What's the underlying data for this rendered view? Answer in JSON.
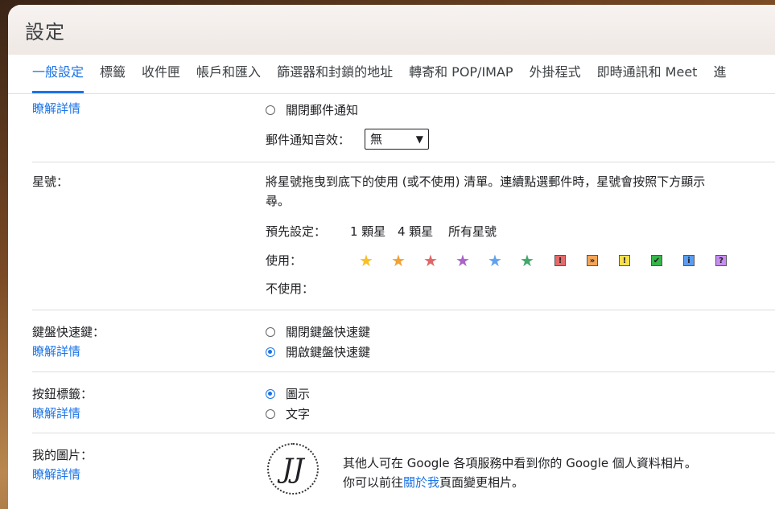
{
  "header": {
    "title": "設定"
  },
  "tabs": [
    {
      "label": "一般設定"
    },
    {
      "label": "標籤"
    },
    {
      "label": "收件匣"
    },
    {
      "label": "帳戶和匯入"
    },
    {
      "label": "篩選器和封鎖的地址"
    },
    {
      "label": "轉寄和 POP/IMAP"
    },
    {
      "label": "外掛程式"
    },
    {
      "label": "即時通訊和 Meet"
    },
    {
      "label": "進"
    }
  ],
  "notify": {
    "learn_more": "瞭解詳情",
    "off_option": "關閉郵件通知",
    "sound_label": "郵件通知音效：",
    "sound_value": "無"
  },
  "stars": {
    "label": "星號：",
    "desc1": "將星號拖曳到底下的使用 (或不使用) 清單。連續點選郵件時，星號會按照下方顯示",
    "desc2": "尋。",
    "preset_label": "預先設定：",
    "preset_1": "1 顆星",
    "preset_4": "4 顆星",
    "preset_all": "所有星號",
    "in_use_label": "使用：",
    "not_in_use_label": "不使用：",
    "icons": [
      {
        "name": "yellow-star",
        "color": "#f6c026"
      },
      {
        "name": "orange-star",
        "color": "#f2a133"
      },
      {
        "name": "red-star",
        "color": "#e06666"
      },
      {
        "name": "purple-star",
        "color": "#a964c8"
      },
      {
        "name": "blue-star",
        "color": "#5fa3f0"
      },
      {
        "name": "green-star",
        "color": "#3fa86b"
      },
      {
        "name": "red-bang",
        "color": "#e66a6a",
        "glyph": "!"
      },
      {
        "name": "orange-guillemet",
        "color": "#f3a55a",
        "glyph": "»"
      },
      {
        "name": "yellow-bang",
        "color": "#f8e04e",
        "glyph": "!"
      },
      {
        "name": "green-check",
        "color": "#36b54a",
        "glyph": "✔"
      },
      {
        "name": "blue-info",
        "color": "#5a9cf0",
        "glyph": "i"
      },
      {
        "name": "purple-question",
        "color": "#c68cf2",
        "glyph": "?"
      }
    ]
  },
  "shortcuts": {
    "label": "鍵盤快速鍵：",
    "learn_more": "瞭解詳情",
    "off": "關閉鍵盤快速鍵",
    "on": "開啟鍵盤快速鍵",
    "selected": "on"
  },
  "button_labels": {
    "label": "按鈕標籤：",
    "learn_more": "瞭解詳情",
    "icons": "圖示",
    "text": "文字",
    "selected": "icons"
  },
  "picture": {
    "label": "我的圖片：",
    "learn_more": "瞭解詳情",
    "line1": "其他人可在 Google 各項服務中看到你的 Google 個人資料相片。",
    "line2_pre": "你可以前往",
    "line2_link": "關於我",
    "line2_post": "頁面變更相片。",
    "avatar_glyph": "JJ"
  }
}
